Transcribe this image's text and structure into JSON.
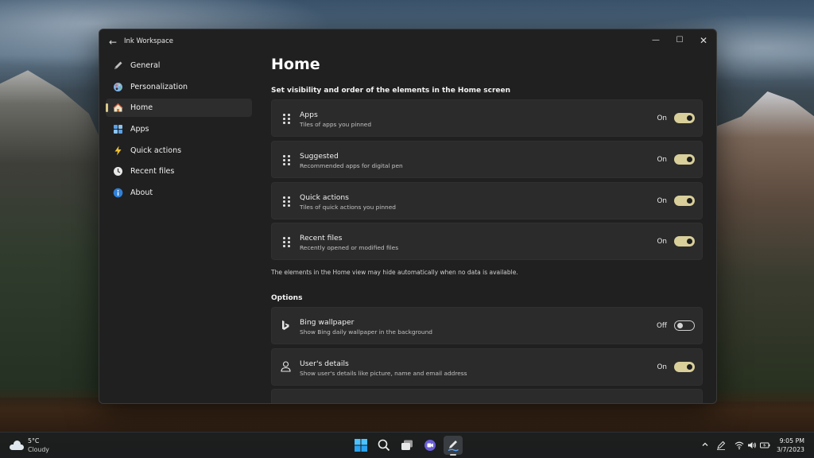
{
  "window": {
    "app_title": "Ink Workspace",
    "back_glyph": "←",
    "minimize_glyph": "—",
    "maximize_glyph": "☐",
    "close_glyph": "✕"
  },
  "sidebar": {
    "items": [
      {
        "label": "General",
        "icon": "pen-icon",
        "active": false
      },
      {
        "label": "Personalization",
        "icon": "palette-icon",
        "active": false
      },
      {
        "label": "Home",
        "icon": "home-icon",
        "active": true
      },
      {
        "label": "Apps",
        "icon": "apps-icon",
        "active": false
      },
      {
        "label": "Quick actions",
        "icon": "lightning-icon",
        "active": false
      },
      {
        "label": "Recent files",
        "icon": "clock-icon",
        "active": false
      },
      {
        "label": "About",
        "icon": "info-icon",
        "active": false
      }
    ]
  },
  "main": {
    "title": "Home",
    "visibility_heading": "Set visibility and order of the elements in the Home screen",
    "elements": [
      {
        "title": "Apps",
        "subtitle": "Tiles of apps you pinned",
        "state": "On"
      },
      {
        "title": "Suggested",
        "subtitle": "Recommended apps for digital pen",
        "state": "On"
      },
      {
        "title": "Quick actions",
        "subtitle": "Tiles of quick actions you pinned",
        "state": "On"
      },
      {
        "title": "Recent files",
        "subtitle": "Recently opened or modified files",
        "state": "On"
      }
    ],
    "note": "The elements in the Home view may hide automatically when no data is available.",
    "options_heading": "Options",
    "options": [
      {
        "title": "Bing wallpaper",
        "subtitle": "Show Bing daily wallpaper in the background",
        "state": "Off",
        "icon": "bing-icon"
      },
      {
        "title": "User's details",
        "subtitle": "Show user's details like picture, name and email address",
        "state": "On",
        "icon": "user-icon"
      }
    ]
  },
  "taskbar": {
    "weather_temp": "5°C",
    "weather_condition": "Cloudy",
    "time": "9:05 PM",
    "date": "3/7/2023",
    "apps": [
      "windows-start-icon",
      "search-icon",
      "task-view-icon",
      "teams-chat-icon",
      "ink-workspace-icon"
    ],
    "tray": [
      "chevron-up-icon",
      "pen-menu-icon",
      "wifi-icon",
      "volume-icon",
      "battery-icon"
    ]
  },
  "colors": {
    "accent": "#d9cf9a",
    "window_bg": "#202020",
    "card_bg": "#2b2b2b"
  }
}
